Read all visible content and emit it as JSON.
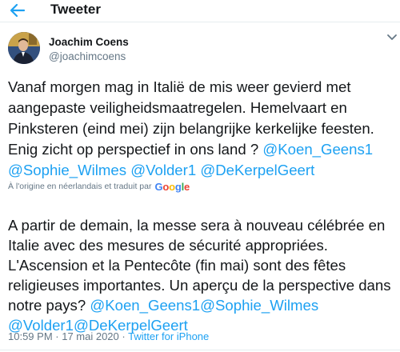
{
  "header": {
    "title": "Tweeter"
  },
  "author": {
    "name": "Joachim Coens",
    "handle": "@joachimcoens"
  },
  "tweet": {
    "original_segments": [
      {
        "text": "Vanaf morgen mag in Italië de mis weer gevierd met aangepaste veiligheidsmaatregelen. Hemelvaart en Pinksteren (eind mei) zijn belangrijke kerkelijke feesten. Enig zicht op perspectief in ons land ? ",
        "mention": false
      },
      {
        "text": "@Koen_Geens1",
        "mention": true
      },
      {
        "text": " ",
        "mention": false
      },
      {
        "text": "@Sophie_Wilmes",
        "mention": true
      },
      {
        "text": " ",
        "mention": false
      },
      {
        "text": "@Volder1",
        "mention": true
      },
      {
        "text": " ",
        "mention": false
      },
      {
        "text": "@DeKerpelGeert",
        "mention": true
      }
    ],
    "translated_note": "À l'origine en néerlandais et traduit par",
    "translator_brand": "Google",
    "translation_segments": [
      {
        "text": "A partir de demain, la messe sera à nouveau célébrée en Italie avec des mesures de sécurité appropriées. L'Ascension et la Pentecôte (fin mai) sont des fêtes religieuses importantes. Un aperçu de la perspective dans notre pays? ",
        "mention": false
      },
      {
        "text": "@Koen_Geens1",
        "mention": true
      },
      {
        "text": "@Sophie_Wilmes",
        "mention": true
      },
      {
        "text": " ",
        "mention": false
      },
      {
        "text": "@Volder1",
        "mention": true
      },
      {
        "text": "@DeKerpelGeert",
        "mention": true
      }
    ],
    "time": "10:59 PM",
    "separator": " · ",
    "date": "17 mai 2020",
    "source": "Twitter for iPhone"
  },
  "colors": {
    "accent": "#1da1f2",
    "secondary_text": "#657786",
    "primary_text": "#14171a"
  },
  "icons": {
    "back": "arrow-left-icon",
    "more": "chevron-down-icon",
    "avatar": "avatar"
  }
}
